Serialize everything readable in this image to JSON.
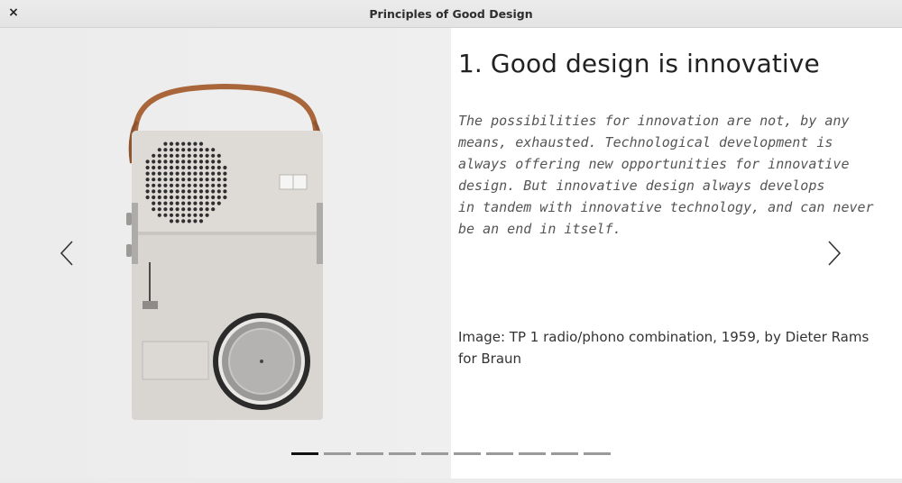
{
  "window": {
    "title": "Principles of Good Design",
    "close_label": "×"
  },
  "slide": {
    "heading": "1. Good design is innovative",
    "body_lines": [
      "The possibilities for innovation are not, by any",
      "means, exhausted. Technological development is",
      "always offering new opportunities for innovative",
      "design. But innovative design always develops",
      "in tandem with innovative technology, and can never",
      "be an end in itself."
    ],
    "caption": "Image: TP 1 radio/phono combination, 1959, by Dieter Rams for Braun",
    "image_subject": "TP 1 radio/phono combination"
  },
  "navigation": {
    "prev_icon": "chevron-left-icon",
    "next_icon": "chevron-right-icon"
  },
  "pager": {
    "total": 10,
    "current": 1
  },
  "colors": {
    "active_dot": "#111111",
    "inactive_dot": "#9a9a9a",
    "image_background": "#ececec",
    "strap": "#a8663a"
  }
}
